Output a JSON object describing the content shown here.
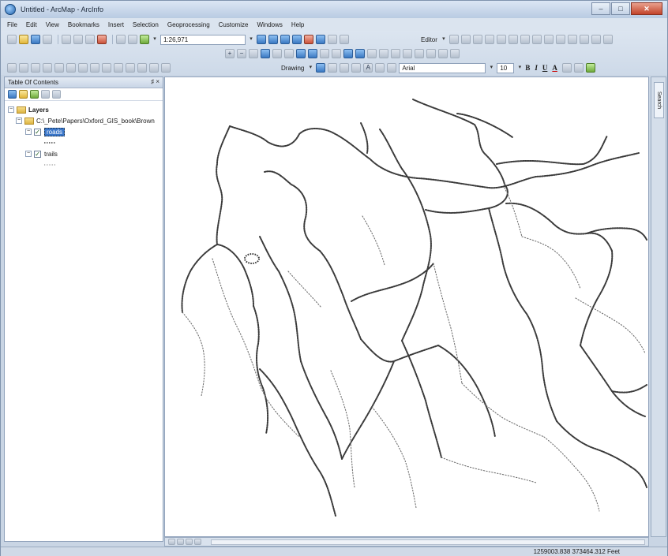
{
  "window": {
    "title": "Untitled - ArcMap - ArcInfo",
    "controls": [
      "–",
      "□",
      "✕"
    ]
  },
  "menu": [
    "File",
    "Edit",
    "View",
    "Bookmarks",
    "Insert",
    "Selection",
    "Geoprocessing",
    "Customize",
    "Windows",
    "Help"
  ],
  "toolbar": {
    "scale_value": "1:26,971",
    "editor_label": "Editor",
    "drawing_label": "Drawing",
    "font_name": "Arial",
    "font_size": "10",
    "format_bold": "B",
    "format_italic": "I",
    "format_underline": "U",
    "text_color": "A"
  },
  "toc": {
    "title": "Table Of Contents",
    "controls": "♯ ×",
    "root_label": "Layers",
    "path_label": "C:\\_Pete\\Papers\\Oxford_GIS_book\\Brown",
    "layers": [
      {
        "name": "roads",
        "checked": true,
        "selected": true
      },
      {
        "name": "trails",
        "checked": true,
        "selected": false
      }
    ],
    "check_mark": "✓",
    "expand_symbol": "−"
  },
  "search_tab_label": "Search",
  "status": {
    "coordinates": "1259003.838  373464.312 Feet"
  }
}
